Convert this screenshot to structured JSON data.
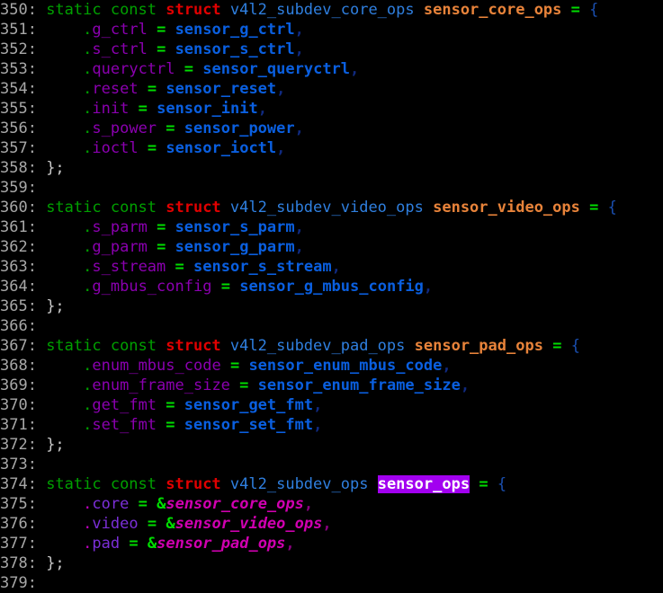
{
  "editor": {
    "background": "#000000",
    "font_size_px": 17,
    "line_height_px": 22,
    "line_number_color": "#a8a8a8",
    "highlight_color": "#a200f0",
    "highlight_text_color": "#ffffff",
    "search_highlight_term": "sensor_ops",
    "first_line": 350,
    "last_line": 379
  },
  "palette": {
    "keyword_green": "#00a000",
    "struct_red": "#e00000",
    "type_blue": "#2f7fdf",
    "variable_orange": "#e8833a",
    "operator_green": "#00dd00",
    "field_purple": "#8b00b0",
    "field_violet": "#7b2fd8",
    "value_blue": "#0a5fe0",
    "value_magenta_italic": "#d000b0",
    "brace_blue": "#1a4fb0",
    "punct_gray": "#c8c8c8"
  },
  "lines": [
    {
      "num": "350:",
      "tokens": [
        {
          "c": "t-kw",
          "t": " static const "
        },
        {
          "c": "t-struct",
          "t": "struct"
        },
        {
          "c": "t-plain",
          "t": " "
        },
        {
          "c": "t-type",
          "t": "v4l2_subdev_core_ops"
        },
        {
          "c": "t-plain",
          "t": " "
        },
        {
          "c": "t-var",
          "t": "sensor_core_ops"
        },
        {
          "c": "t-plain",
          "t": " "
        },
        {
          "c": "t-op",
          "t": "="
        },
        {
          "c": "t-plain",
          "t": " "
        },
        {
          "c": "t-brace",
          "t": "{"
        }
      ]
    },
    {
      "num": "351:",
      "tokens": [
        {
          "c": "t-plain",
          "t": "     "
        },
        {
          "c": "t-dot",
          "t": "."
        },
        {
          "c": "t-field",
          "t": "g_ctrl"
        },
        {
          "c": "t-plain",
          "t": " "
        },
        {
          "c": "t-op",
          "t": "="
        },
        {
          "c": "t-plain",
          "t": " "
        },
        {
          "c": "t-val",
          "t": "sensor_g_ctrl"
        },
        {
          "c": "t-comma",
          "t": ","
        }
      ]
    },
    {
      "num": "352:",
      "tokens": [
        {
          "c": "t-plain",
          "t": "     "
        },
        {
          "c": "t-dot",
          "t": "."
        },
        {
          "c": "t-field",
          "t": "s_ctrl"
        },
        {
          "c": "t-plain",
          "t": " "
        },
        {
          "c": "t-op",
          "t": "="
        },
        {
          "c": "t-plain",
          "t": " "
        },
        {
          "c": "t-val",
          "t": "sensor_s_ctrl"
        },
        {
          "c": "t-comma",
          "t": ","
        }
      ]
    },
    {
      "num": "353:",
      "tokens": [
        {
          "c": "t-plain",
          "t": "     "
        },
        {
          "c": "t-dot",
          "t": "."
        },
        {
          "c": "t-field",
          "t": "queryctrl"
        },
        {
          "c": "t-plain",
          "t": " "
        },
        {
          "c": "t-op",
          "t": "="
        },
        {
          "c": "t-plain",
          "t": " "
        },
        {
          "c": "t-val",
          "t": "sensor_queryctrl"
        },
        {
          "c": "t-comma",
          "t": ","
        }
      ]
    },
    {
      "num": "354:",
      "tokens": [
        {
          "c": "t-plain",
          "t": "     "
        },
        {
          "c": "t-dot",
          "t": "."
        },
        {
          "c": "t-field",
          "t": "reset"
        },
        {
          "c": "t-plain",
          "t": " "
        },
        {
          "c": "t-op",
          "t": "="
        },
        {
          "c": "t-plain",
          "t": " "
        },
        {
          "c": "t-val",
          "t": "sensor_reset"
        },
        {
          "c": "t-comma",
          "t": ","
        }
      ]
    },
    {
      "num": "355:",
      "tokens": [
        {
          "c": "t-plain",
          "t": "     "
        },
        {
          "c": "t-dot",
          "t": "."
        },
        {
          "c": "t-field",
          "t": "init"
        },
        {
          "c": "t-plain",
          "t": " "
        },
        {
          "c": "t-op",
          "t": "="
        },
        {
          "c": "t-plain",
          "t": " "
        },
        {
          "c": "t-val",
          "t": "sensor_init"
        },
        {
          "c": "t-comma",
          "t": ","
        }
      ]
    },
    {
      "num": "356:",
      "tokens": [
        {
          "c": "t-plain",
          "t": "     "
        },
        {
          "c": "t-dot",
          "t": "."
        },
        {
          "c": "t-field",
          "t": "s_power"
        },
        {
          "c": "t-plain",
          "t": " "
        },
        {
          "c": "t-op",
          "t": "="
        },
        {
          "c": "t-plain",
          "t": " "
        },
        {
          "c": "t-val",
          "t": "sensor_power"
        },
        {
          "c": "t-comma",
          "t": ","
        }
      ]
    },
    {
      "num": "357:",
      "tokens": [
        {
          "c": "t-plain",
          "t": "     "
        },
        {
          "c": "t-dot",
          "t": "."
        },
        {
          "c": "t-field",
          "t": "ioctl"
        },
        {
          "c": "t-plain",
          "t": " "
        },
        {
          "c": "t-op",
          "t": "="
        },
        {
          "c": "t-plain",
          "t": " "
        },
        {
          "c": "t-val",
          "t": "sensor_ioctl"
        },
        {
          "c": "t-comma",
          "t": ","
        }
      ]
    },
    {
      "num": "358:",
      "tokens": [
        {
          "c": "t-punct",
          "t": " };"
        }
      ]
    },
    {
      "num": "359:",
      "tokens": []
    },
    {
      "num": "360:",
      "tokens": [
        {
          "c": "t-kw",
          "t": " static const "
        },
        {
          "c": "t-struct",
          "t": "struct"
        },
        {
          "c": "t-plain",
          "t": " "
        },
        {
          "c": "t-type",
          "t": "v4l2_subdev_video_ops"
        },
        {
          "c": "t-plain",
          "t": " "
        },
        {
          "c": "t-var",
          "t": "sensor_video_ops"
        },
        {
          "c": "t-plain",
          "t": " "
        },
        {
          "c": "t-op",
          "t": "="
        },
        {
          "c": "t-plain",
          "t": " "
        },
        {
          "c": "t-brace",
          "t": "{"
        }
      ]
    },
    {
      "num": "361:",
      "tokens": [
        {
          "c": "t-plain",
          "t": "     "
        },
        {
          "c": "t-dot",
          "t": "."
        },
        {
          "c": "t-field",
          "t": "s_parm"
        },
        {
          "c": "t-plain",
          "t": " "
        },
        {
          "c": "t-op",
          "t": "="
        },
        {
          "c": "t-plain",
          "t": " "
        },
        {
          "c": "t-val",
          "t": "sensor_s_parm"
        },
        {
          "c": "t-comma",
          "t": ","
        }
      ]
    },
    {
      "num": "362:",
      "tokens": [
        {
          "c": "t-plain",
          "t": "     "
        },
        {
          "c": "t-dot",
          "t": "."
        },
        {
          "c": "t-field",
          "t": "g_parm"
        },
        {
          "c": "t-plain",
          "t": " "
        },
        {
          "c": "t-op",
          "t": "="
        },
        {
          "c": "t-plain",
          "t": " "
        },
        {
          "c": "t-val",
          "t": "sensor_g_parm"
        },
        {
          "c": "t-comma",
          "t": ","
        }
      ]
    },
    {
      "num": "363:",
      "tokens": [
        {
          "c": "t-plain",
          "t": "     "
        },
        {
          "c": "t-dot",
          "t": "."
        },
        {
          "c": "t-field",
          "t": "s_stream"
        },
        {
          "c": "t-plain",
          "t": " "
        },
        {
          "c": "t-op",
          "t": "="
        },
        {
          "c": "t-plain",
          "t": " "
        },
        {
          "c": "t-val",
          "t": "sensor_s_stream"
        },
        {
          "c": "t-comma",
          "t": ","
        }
      ]
    },
    {
      "num": "364:",
      "tokens": [
        {
          "c": "t-plain",
          "t": "     "
        },
        {
          "c": "t-dot",
          "t": "."
        },
        {
          "c": "t-field",
          "t": "g_mbus_config"
        },
        {
          "c": "t-plain",
          "t": " "
        },
        {
          "c": "t-op",
          "t": "="
        },
        {
          "c": "t-plain",
          "t": " "
        },
        {
          "c": "t-val",
          "t": "sensor_g_mbus_config"
        },
        {
          "c": "t-comma",
          "t": ","
        }
      ]
    },
    {
      "num": "365:",
      "tokens": [
        {
          "c": "t-punct",
          "t": " };"
        }
      ]
    },
    {
      "num": "366:",
      "tokens": []
    },
    {
      "num": "367:",
      "tokens": [
        {
          "c": "t-kw",
          "t": " static const "
        },
        {
          "c": "t-struct",
          "t": "struct"
        },
        {
          "c": "t-plain",
          "t": " "
        },
        {
          "c": "t-type",
          "t": "v4l2_subdev_pad_ops"
        },
        {
          "c": "t-plain",
          "t": " "
        },
        {
          "c": "t-var",
          "t": "sensor_pad_ops"
        },
        {
          "c": "t-plain",
          "t": " "
        },
        {
          "c": "t-op",
          "t": "="
        },
        {
          "c": "t-plain",
          "t": " "
        },
        {
          "c": "t-brace",
          "t": "{"
        }
      ]
    },
    {
      "num": "368:",
      "tokens": [
        {
          "c": "t-plain",
          "t": "     "
        },
        {
          "c": "t-dot",
          "t": "."
        },
        {
          "c": "t-field",
          "t": "enum_mbus_code"
        },
        {
          "c": "t-plain",
          "t": " "
        },
        {
          "c": "t-op",
          "t": "="
        },
        {
          "c": "t-plain",
          "t": " "
        },
        {
          "c": "t-val",
          "t": "sensor_enum_mbus_code"
        },
        {
          "c": "t-comma",
          "t": ","
        }
      ]
    },
    {
      "num": "369:",
      "tokens": [
        {
          "c": "t-plain",
          "t": "     "
        },
        {
          "c": "t-dot",
          "t": "."
        },
        {
          "c": "t-field",
          "t": "enum_frame_size"
        },
        {
          "c": "t-plain",
          "t": " "
        },
        {
          "c": "t-op",
          "t": "="
        },
        {
          "c": "t-plain",
          "t": " "
        },
        {
          "c": "t-val",
          "t": "sensor_enum_frame_size"
        },
        {
          "c": "t-comma",
          "t": ","
        }
      ]
    },
    {
      "num": "370:",
      "tokens": [
        {
          "c": "t-plain",
          "t": "     "
        },
        {
          "c": "t-dot",
          "t": "."
        },
        {
          "c": "t-field",
          "t": "get_fmt"
        },
        {
          "c": "t-plain",
          "t": " "
        },
        {
          "c": "t-op",
          "t": "="
        },
        {
          "c": "t-plain",
          "t": " "
        },
        {
          "c": "t-val",
          "t": "sensor_get_fmt"
        },
        {
          "c": "t-comma",
          "t": ","
        }
      ]
    },
    {
      "num": "371:",
      "tokens": [
        {
          "c": "t-plain",
          "t": "     "
        },
        {
          "c": "t-dot",
          "t": "."
        },
        {
          "c": "t-field",
          "t": "set_fmt"
        },
        {
          "c": "t-plain",
          "t": " "
        },
        {
          "c": "t-op",
          "t": "="
        },
        {
          "c": "t-plain",
          "t": " "
        },
        {
          "c": "t-val",
          "t": "sensor_set_fmt"
        },
        {
          "c": "t-comma",
          "t": ","
        }
      ]
    },
    {
      "num": "372:",
      "tokens": [
        {
          "c": "t-punct",
          "t": " };"
        }
      ]
    },
    {
      "num": "373:",
      "tokens": []
    },
    {
      "num": "374:",
      "tokens": [
        {
          "c": "t-kw",
          "t": " static const "
        },
        {
          "c": "t-struct",
          "t": "struct"
        },
        {
          "c": "t-plain",
          "t": " "
        },
        {
          "c": "t-type",
          "t": "v4l2_subdev_ops"
        },
        {
          "c": "t-plain",
          "t": " "
        },
        {
          "c": "t-hl",
          "t": "sensor_ops"
        },
        {
          "c": "t-plain",
          "t": " "
        },
        {
          "c": "t-op",
          "t": "="
        },
        {
          "c": "t-plain",
          "t": " "
        },
        {
          "c": "t-brace",
          "t": "{"
        }
      ]
    },
    {
      "num": "375:",
      "tokens": [
        {
          "c": "t-plain",
          "t": "     "
        },
        {
          "c": "t-dotm",
          "t": "."
        },
        {
          "c": "t-field2",
          "t": "core"
        },
        {
          "c": "t-plain",
          "t": " "
        },
        {
          "c": "t-op",
          "t": "="
        },
        {
          "c": "t-plain",
          "t": " "
        },
        {
          "c": "t-op",
          "t": "&"
        },
        {
          "c": "t-valit",
          "t": "sensor_core_ops"
        },
        {
          "c": "t-commam",
          "t": ","
        }
      ]
    },
    {
      "num": "376:",
      "tokens": [
        {
          "c": "t-plain",
          "t": "     "
        },
        {
          "c": "t-dotm",
          "t": "."
        },
        {
          "c": "t-field2",
          "t": "video"
        },
        {
          "c": "t-plain",
          "t": " "
        },
        {
          "c": "t-op",
          "t": "="
        },
        {
          "c": "t-plain",
          "t": " "
        },
        {
          "c": "t-op",
          "t": "&"
        },
        {
          "c": "t-valit",
          "t": "sensor_video_ops"
        },
        {
          "c": "t-commam",
          "t": ","
        }
      ]
    },
    {
      "num": "377:",
      "tokens": [
        {
          "c": "t-plain",
          "t": "     "
        },
        {
          "c": "t-dotm",
          "t": "."
        },
        {
          "c": "t-field2",
          "t": "pad"
        },
        {
          "c": "t-plain",
          "t": " "
        },
        {
          "c": "t-op",
          "t": "="
        },
        {
          "c": "t-plain",
          "t": " "
        },
        {
          "c": "t-op",
          "t": "&"
        },
        {
          "c": "t-valit",
          "t": "sensor_pad_ops"
        },
        {
          "c": "t-commam",
          "t": ","
        }
      ]
    },
    {
      "num": "378:",
      "tokens": [
        {
          "c": "t-punct",
          "t": " };"
        }
      ]
    },
    {
      "num": "379:",
      "tokens": []
    }
  ]
}
